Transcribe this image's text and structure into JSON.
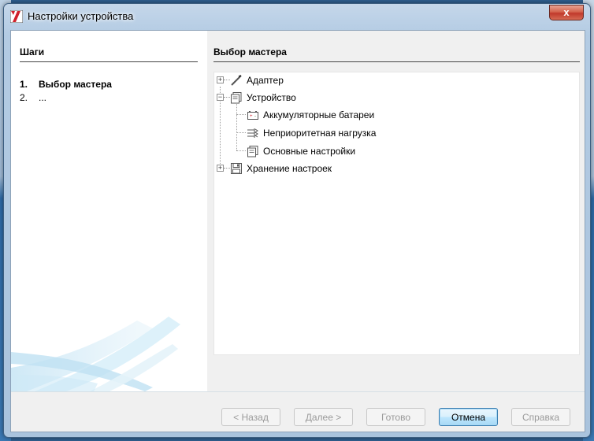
{
  "window": {
    "title": "Настройки устройства",
    "close_label": "x"
  },
  "steps": {
    "title": "Шаги",
    "items": [
      {
        "num": "1.",
        "label": "Выбор мастера"
      },
      {
        "num": "2.",
        "label": "..."
      }
    ]
  },
  "main": {
    "title": "Выбор мастера",
    "tree": {
      "adapter": {
        "label": "Адаптер",
        "expander": "+",
        "icon": "pen-icon"
      },
      "device": {
        "label": "Устройство",
        "expander": "−",
        "icon": "window-icon",
        "children": [
          {
            "label": "Аккумуляторные батареи",
            "icon": "battery-icon"
          },
          {
            "label": "Неприоритетная нагрузка",
            "icon": "load-icon"
          },
          {
            "label": "Основные настройки",
            "icon": "window-icon"
          }
        ]
      },
      "storage": {
        "label": "Хранение настроек",
        "expander": "+",
        "icon": "floppy-icon"
      }
    }
  },
  "buttons": {
    "back": "< Назад",
    "next": "Далее >",
    "finish": "Готово",
    "cancel": "Отмена",
    "help": "Справка"
  },
  "colors": {
    "accent_icon": "#d0202a",
    "default_button_border": "#3c7fb1"
  }
}
